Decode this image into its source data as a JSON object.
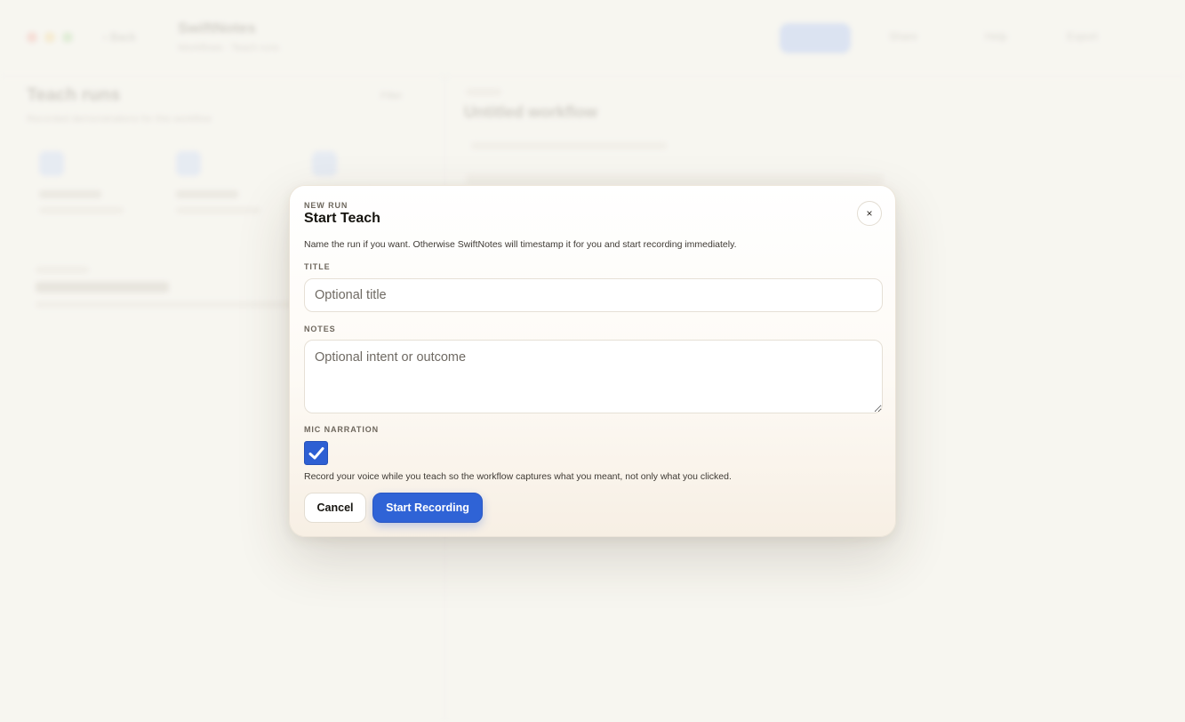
{
  "background": {
    "nav_back": "‹ Back",
    "doc_title": "SwiftNotes",
    "doc_subtitle": "Workflows · Teach runs",
    "buttons": [
      "Share",
      "Help",
      "Export"
    ],
    "left_title": "Teach runs",
    "left_subtitle": "Recorded demonstrations for this workflow",
    "filter_label": "Filter",
    "right_title": "Untitled workflow"
  },
  "modal": {
    "kicker": "NEW RUN",
    "title": "Start Teach",
    "close_label": "×",
    "description": "Name the run if you want. Otherwise SwiftNotes will timestamp it for you and start recording immediately.",
    "title_field": {
      "label": "TITLE",
      "value": "",
      "placeholder": "Optional title"
    },
    "notes_field": {
      "label": "NOTES",
      "value": "",
      "placeholder": "Optional intent or outcome"
    },
    "mic_narration": {
      "label": "MIC NARRATION",
      "checked": true,
      "help_text": "Record your voice while you teach so the workflow captures what you meant, not only what you clicked."
    },
    "cancel_label": "Cancel",
    "primary_label": "Start Recording",
    "accent_color": "#2f63d6"
  }
}
